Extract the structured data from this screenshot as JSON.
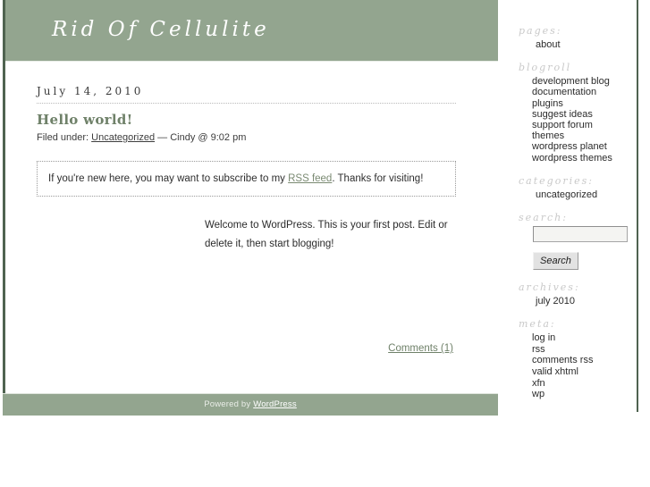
{
  "site": {
    "title": "Rid Of Cellulite"
  },
  "post": {
    "date": "July 14, 2010",
    "title": "Hello world!",
    "meta_prefix": "Filed under:",
    "category": "Uncategorized",
    "meta_suffix": "— Cindy @ 9:02 pm",
    "rss_notice_before": "If you're new here, you may want to subscribe to my",
    "rss_link": "RSS feed",
    "rss_notice_after": ". Thanks for visiting!",
    "body": "Welcome to WordPress. This is your first post. Edit or delete it, then start blogging!",
    "comments_link": "Comments (1)"
  },
  "footer": {
    "powered_by": "Powered by",
    "wordpress": "WordPress"
  },
  "sidebar": {
    "pages": {
      "heading": "pages:",
      "items": [
        "about"
      ]
    },
    "blogroll": {
      "heading": "blogroll",
      "items": [
        "development blog",
        "documentation",
        "plugins",
        "suggest ideas",
        "support forum",
        "themes",
        "wordpress planet",
        "wordpress themes"
      ]
    },
    "categories": {
      "heading": "categories:",
      "items": [
        "uncategorized"
      ]
    },
    "search": {
      "heading": "search:",
      "value": "",
      "placeholder": "",
      "button_label": "Search"
    },
    "archives": {
      "heading": "archives:",
      "items": [
        "july 2010"
      ]
    },
    "meta": {
      "heading": "meta:",
      "items": [
        "log in",
        "rss",
        "comments rss",
        "valid xhtml",
        "xfn",
        "wp"
      ]
    }
  },
  "colors": {
    "header_green": "#93a58f",
    "border_green": "#4f6350",
    "link_green": "#6f8169",
    "heading_gray": "#c9c9c9"
  }
}
